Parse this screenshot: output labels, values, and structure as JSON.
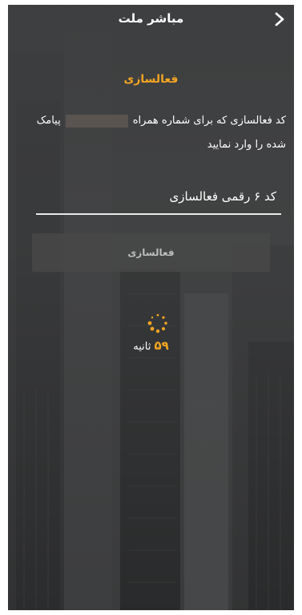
{
  "header": {
    "title": "مباشر ملت",
    "back_icon": "chevron-right-icon"
  },
  "activation": {
    "title": "فعالسازی",
    "desc_before": "کد فعالسازی که برای شماره همراه",
    "desc_after": "پیامک شده را وارد نمایید",
    "input_placeholder": "کد ۶ رقمی فعالسازی",
    "button_label": "فعالسازی"
  },
  "timer": {
    "seconds": "۵۹",
    "unit": "ثانیه"
  },
  "colors": {
    "accent": "#f4a623",
    "background": "#3a3b3c"
  }
}
